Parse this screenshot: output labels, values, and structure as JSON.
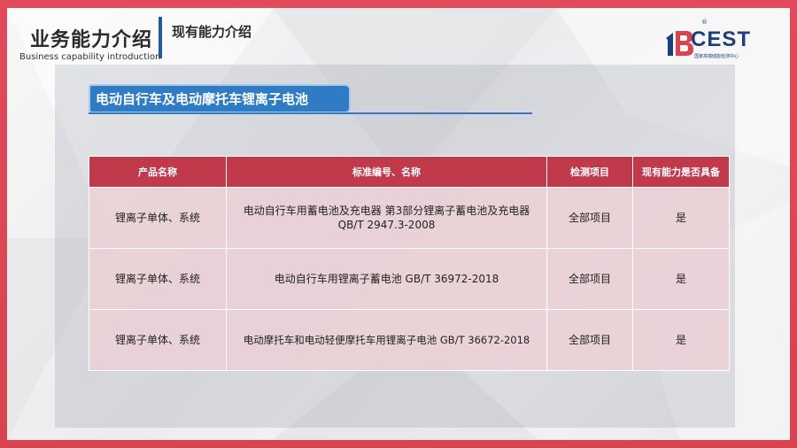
{
  "header": {
    "title": "业务能力介绍",
    "subtitle": "Business capability introduction",
    "section": "现有能力介绍"
  },
  "logo": {
    "name": "CEST",
    "tagline": "国家高端储能检测中心",
    "colors": {
      "mark": "#1d3f7a",
      "accent": "#d8434f"
    }
  },
  "topic": {
    "title": "电动自行车及电动摩托车锂离子电池"
  },
  "colors": {
    "frame": "#d8434f",
    "table_header": "#c03a4b",
    "table_cell": "#ecd2d6",
    "topic_tab": "#2f7bc4",
    "title_bar": "#1f5aa6"
  },
  "table": {
    "headers": [
      "产品名称",
      "标准编号、名称",
      "检测项目",
      "现有能力是否具备"
    ],
    "rows": [
      {
        "product": "锂离子单体、系统",
        "standard_name": "电动自行车用蓄电池及充电器 第3部分锂离子蓄电池及充电器",
        "standard_code": "QB/T 2947.3-2008",
        "test_items": "全部项目",
        "capable": "是"
      },
      {
        "product": "锂离子单体、系统",
        "standard_name": "电动自行车用锂离子蓄电池",
        "standard_code": "GB/T 36972-2018",
        "test_items": "全部项目",
        "capable": "是"
      },
      {
        "product": "锂离子单体、系统",
        "standard_name": "电动摩托车和电动轻便摩托车用锂离子电池",
        "standard_code": "GB/T 36672-2018",
        "test_items": "全部项目",
        "capable": "是"
      }
    ]
  }
}
